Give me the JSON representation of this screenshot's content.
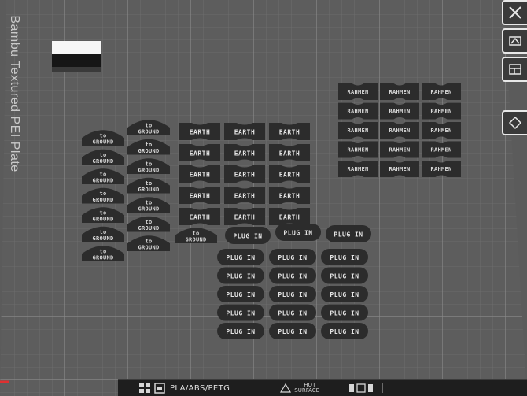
{
  "plate": {
    "label": "Bambu Textured PEI Plate",
    "colors": {
      "plate": "#5c5c5c",
      "grid_minor": "#6f6f6f",
      "grid_major": "#8a8a8a",
      "part": "#2c2c2c",
      "text": "#d9d9d9"
    }
  },
  "parts": {
    "ground_label": "to ground",
    "earth_label": "EARTH",
    "rahmen_label": "RAHMEN",
    "plug_label": "PLUG IN"
  },
  "toolbar": {
    "icons": [
      "close-icon",
      "arrange-icon",
      "orient-icon",
      "layout-icon"
    ]
  },
  "status_bar": {
    "filament": "PLA/ABS/PETG",
    "surface_line1": "HOT",
    "surface_line2": "SURFACE"
  }
}
